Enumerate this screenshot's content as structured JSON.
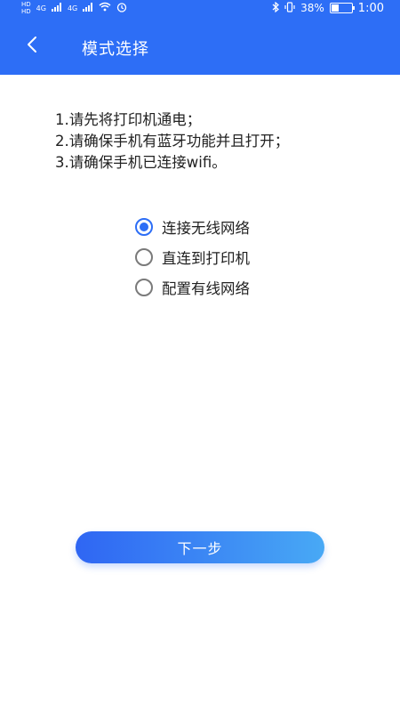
{
  "status_bar": {
    "time": "1:00",
    "battery_text": "38%",
    "battery_level_pct": 38,
    "left_network_small": [
      "HD",
      "HD"
    ],
    "left_network_types": [
      "4G",
      "4G"
    ]
  },
  "app_bar": {
    "title": "模式选择",
    "back_icon": "chevron-left-icon"
  },
  "instructions": [
    "1.请先将打印机通电；",
    "2.请确保手机有蓝牙功能并且打开；",
    "3.请确保手机已连接wifi。"
  ],
  "options": [
    {
      "label": "连接无线网络",
      "selected": true
    },
    {
      "label": "直连到打印机",
      "selected": false
    },
    {
      "label": "配置有线网络",
      "selected": false
    }
  ],
  "next_button": {
    "label": "下一步"
  },
  "colors": {
    "primary": "#2d6ef6",
    "button_gradient_start": "#2f66f3",
    "button_gradient_end": "#48a9f5"
  }
}
